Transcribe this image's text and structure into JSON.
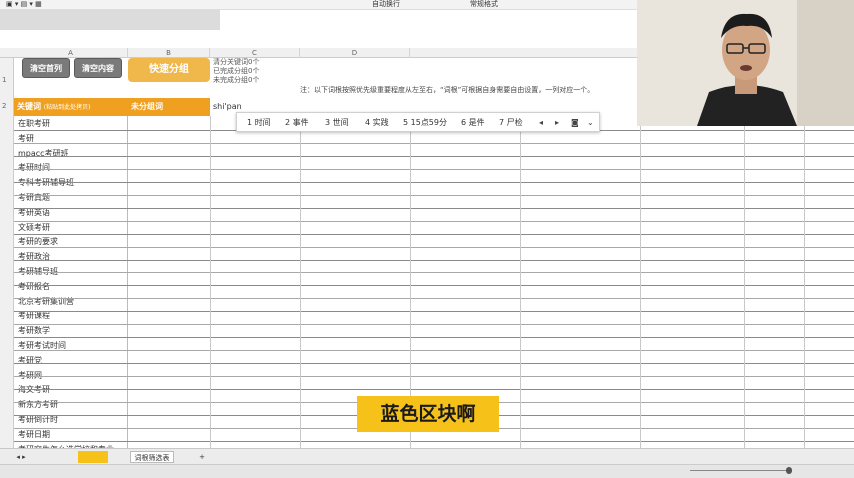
{
  "ribbon": {
    "item1": "自动换行",
    "item2": "常规格式"
  },
  "buttons": {
    "clear_sequence": "清空首列",
    "clear_content": "清空内容",
    "quick_group": "快速分组"
  },
  "stats": {
    "line1": "清分关键词0个",
    "line2": "已完成分组0个",
    "line3": "未完成分组0个"
  },
  "notice": "注：以下词根按照优先级重要程度从左至右，“词根”可根据自身需要自由设置，一列对应一个。",
  "header": {
    "keyword": "关键词",
    "keyword_hint": "(粘贴到此处拷贝)",
    "ungrouped": "未分组词",
    "input_text": "shi'pan"
  },
  "ime": {
    "candidates": [
      "1 时间",
      "2 事件",
      "3 世间",
      "4 实践",
      "5 15点59分",
      "6 是件",
      "7 尸检"
    ],
    "prev": "◂",
    "next": "▸"
  },
  "keywords": [
    "在职考研",
    "考研",
    "mpacc考研班",
    "考研时间",
    "专科考研辅导班",
    "考研真题",
    "考研英语",
    "文硕考研",
    "考研的要求",
    "考研政治",
    "考研辅导班",
    "考研报名",
    "北京考研集训营",
    "考研课程",
    "考研数学",
    "考研考试时间",
    "考研党",
    "考研网",
    "海文考研",
    "新东方考研",
    "考研倒计时",
    "考研日期",
    "考研究生怎么选学校和专业"
  ],
  "row_numbers": [
    "1",
    "2"
  ],
  "caption": "蓝色区块啊",
  "tabs": {
    "active": "词根筛选表",
    "add": "+"
  },
  "colors": {
    "accent_orange": "#f0a020",
    "caption_yellow": "#f6c21a",
    "button_gray": "#7a7a7a"
  }
}
